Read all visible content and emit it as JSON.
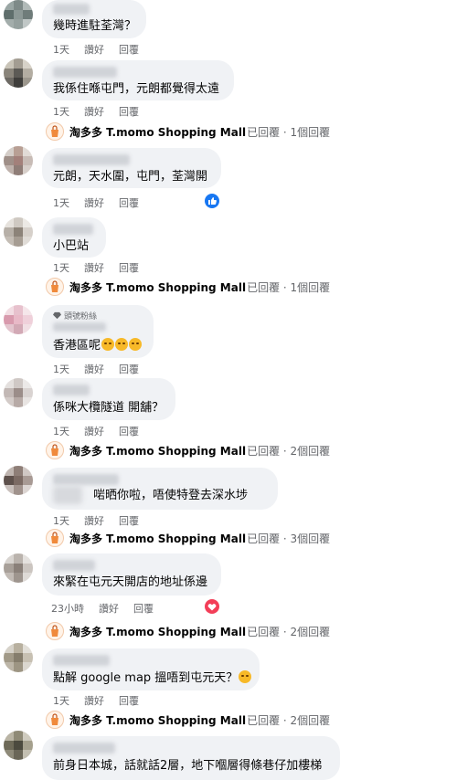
{
  "ui": {
    "accent": "#1877f2",
    "bubble_bg": "#f0f2f5",
    "meta_color": "#65676b",
    "love_color": "#f33e58"
  },
  "labels": {
    "like": "讚好",
    "reply": "回覆"
  },
  "page_name": "淘多多 T.momo Shopping Mall",
  "comments": [
    {
      "text": "幾時進駐荃灣？",
      "time": "1天"
    },
    {
      "text": "我係住喺屯門，元朗都覺得太遠",
      "time": "1天",
      "replies": {
        "suffix": "已回覆 · 1個回覆"
      }
    },
    {
      "text": "元朗，天水圍，屯門，荃灣開",
      "time": "1天",
      "reaction": "like-reaction-icon"
    },
    {
      "text": "小巴站",
      "time": "1天",
      "replies": {
        "suffix": "已回覆 · 1個回覆"
      }
    },
    {
      "badge": "頭號粉絲",
      "text": "香港區呢",
      "emojis": 3,
      "time": "1天"
    },
    {
      "text": "係咪大欖隧道 開舖？",
      "time": "1天",
      "replies": {
        "suffix": "已回覆 · 2個回覆"
      }
    },
    {
      "text": "啱晒你啦，唔使特登去深水埗",
      "time": "1天",
      "replies": {
        "suffix": "已回覆 · 3個回覆"
      }
    },
    {
      "text": "來緊在屯元天開店的地址係邊",
      "time": "23小時",
      "reaction": "love-reaction-icon",
      "replies": {
        "suffix": "已回覆 · 2個回覆"
      }
    },
    {
      "text": "點解 google map 搵唔到屯元天？",
      "time": "1天",
      "emoji": "thinking-face",
      "replies": {
        "suffix": "已回覆 · 2個回覆"
      }
    },
    {
      "text": "前身日本城，話就話2層，地下嗰層得條巷仔加樓梯"
    }
  ]
}
